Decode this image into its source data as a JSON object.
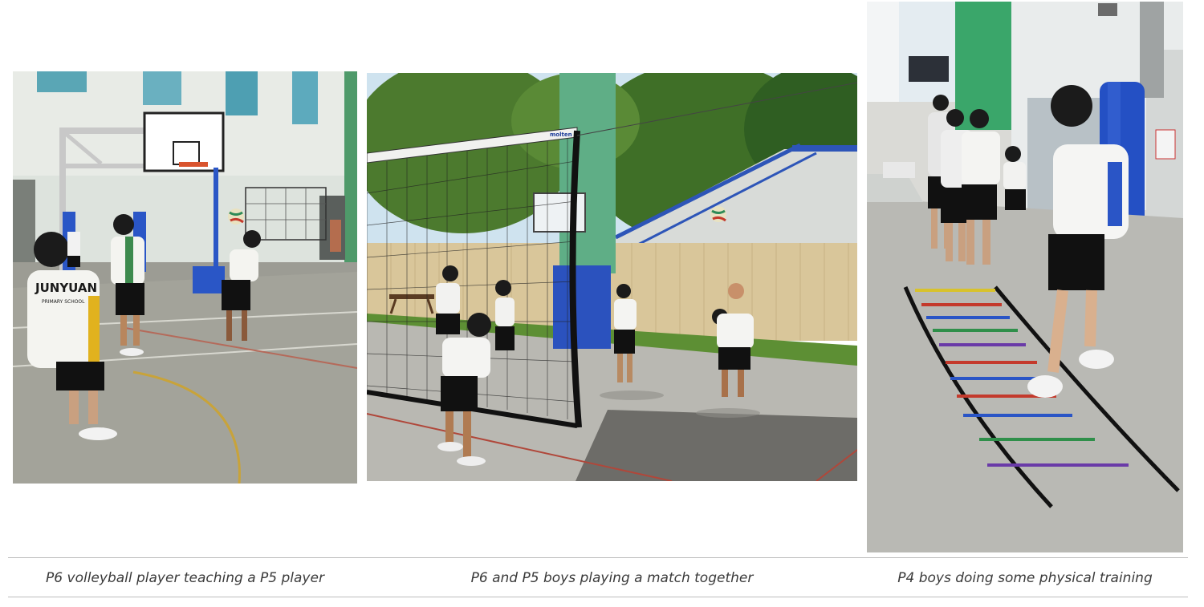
{
  "photos": [
    {
      "caption": "P6 volleyball player teaching a P5 player",
      "jersey_text": "JUNYUAN",
      "jersey_subtext": "PRIMARY SCHOOL"
    },
    {
      "caption": "P6 and P5 boys playing a match together",
      "net_brand": "molten"
    },
    {
      "caption": "P4 boys doing some physical training"
    }
  ]
}
